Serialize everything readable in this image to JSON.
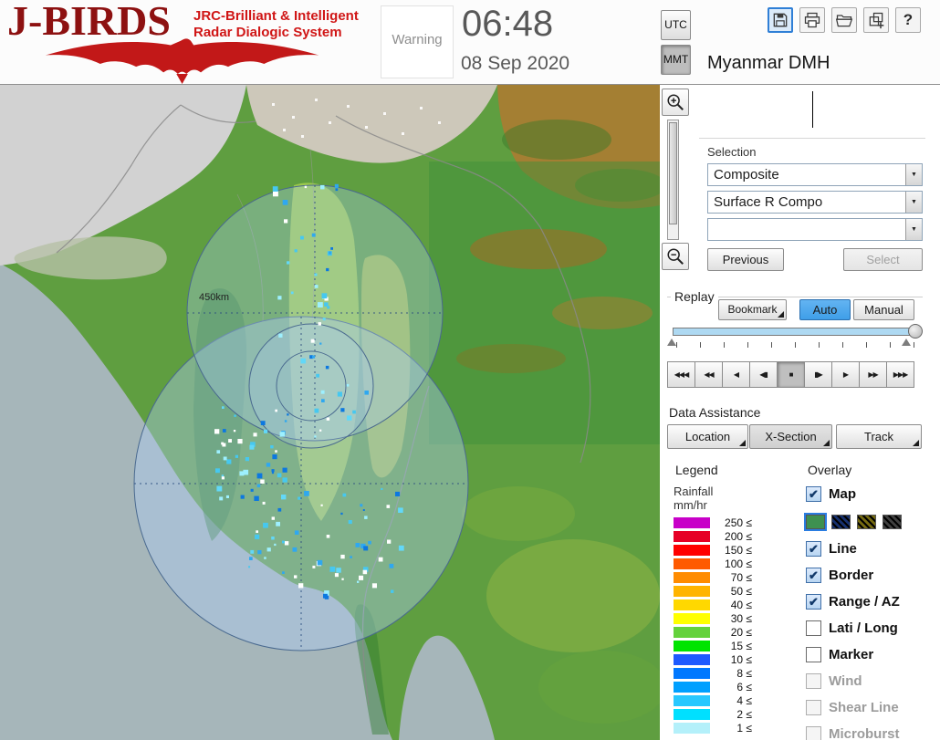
{
  "header": {
    "logo_title": "J-BIRDS",
    "logo_sub1": "JRC-Brilliant & Intelligent",
    "logo_sub2": "Radar  Dialogic  System",
    "warning_label": "Warning",
    "time": "06:48",
    "date": "08 Sep 2020",
    "tz_utc": "UTC",
    "tz_mmt": "MMT",
    "org": "Myanmar DMH",
    "toolbar_icons": [
      "save-icon",
      "print-icon",
      "open-folder-icon",
      "import-icon",
      "help-icon"
    ],
    "help_glyph": "?"
  },
  "map": {
    "range_label": "450km"
  },
  "selection": {
    "label": "Selection",
    "dropdown1": "Composite",
    "dropdown2": "Surface R Compo",
    "dropdown3": "",
    "previous_label": "Previous",
    "select_label": "Select"
  },
  "replay": {
    "label": "Replay",
    "bookmark": "Bookmark",
    "auto": "Auto",
    "manual": "Manual",
    "controls": [
      "◀◀◀",
      "◀◀",
      "◀",
      "◀▮",
      "■",
      "▮▶",
      "▶",
      "▶▶",
      "▶▶▶"
    ],
    "active_index": 4
  },
  "data_assistance": {
    "label": "Data Assistance",
    "buttons": [
      "Location",
      "X-Section",
      "Track"
    ]
  },
  "legend": {
    "label": "Legend",
    "title1": "Rainfall",
    "title2": "mm/hr",
    "suffix": "≤",
    "rows": [
      {
        "value": "250",
        "color": "#c800c8"
      },
      {
        "value": "200",
        "color": "#e60026"
      },
      {
        "value": "150",
        "color": "#ff0000"
      },
      {
        "value": "100",
        "color": "#ff5a00"
      },
      {
        "value": "70",
        "color": "#ff8c00"
      },
      {
        "value": "50",
        "color": "#ffb400"
      },
      {
        "value": "40",
        "color": "#ffd800"
      },
      {
        "value": "30",
        "color": "#ffff00"
      },
      {
        "value": "20",
        "color": "#64d23c"
      },
      {
        "value": "15",
        "color": "#00e400"
      },
      {
        "value": "10",
        "color": "#1e5aff"
      },
      {
        "value": "8",
        "color": "#0078ff"
      },
      {
        "value": "6",
        "color": "#00a0ff"
      },
      {
        "value": "4",
        "color": "#28c8ff"
      },
      {
        "value": "2",
        "color": "#00e0ff"
      },
      {
        "value": "1",
        "color": "#b4f0fa"
      }
    ]
  },
  "overlay": {
    "label": "Overlay",
    "items": [
      {
        "label": "Map",
        "checked": true,
        "enabled": true
      },
      {
        "label": "Line",
        "checked": true,
        "enabled": true
      },
      {
        "label": "Border",
        "checked": true,
        "enabled": true
      },
      {
        "label": "Range / AZ",
        "checked": true,
        "enabled": true
      },
      {
        "label": "Lati / Long",
        "checked": false,
        "enabled": true
      },
      {
        "label": "Marker",
        "checked": false,
        "enabled": true
      },
      {
        "label": "Wind",
        "checked": false,
        "enabled": false
      },
      {
        "label": "Shear Line",
        "checked": false,
        "enabled": false
      },
      {
        "label": "Microburst",
        "checked": false,
        "enabled": false
      }
    ],
    "map_swatches": [
      "#3e9150",
      "#16306e",
      "#756a10",
      "#3f3f3f"
    ],
    "selected_swatch": 0
  },
  "colors": {
    "accent_blue": "#3f9fe8",
    "logo_red": "#c21818",
    "sea": "#a6b6ba"
  }
}
